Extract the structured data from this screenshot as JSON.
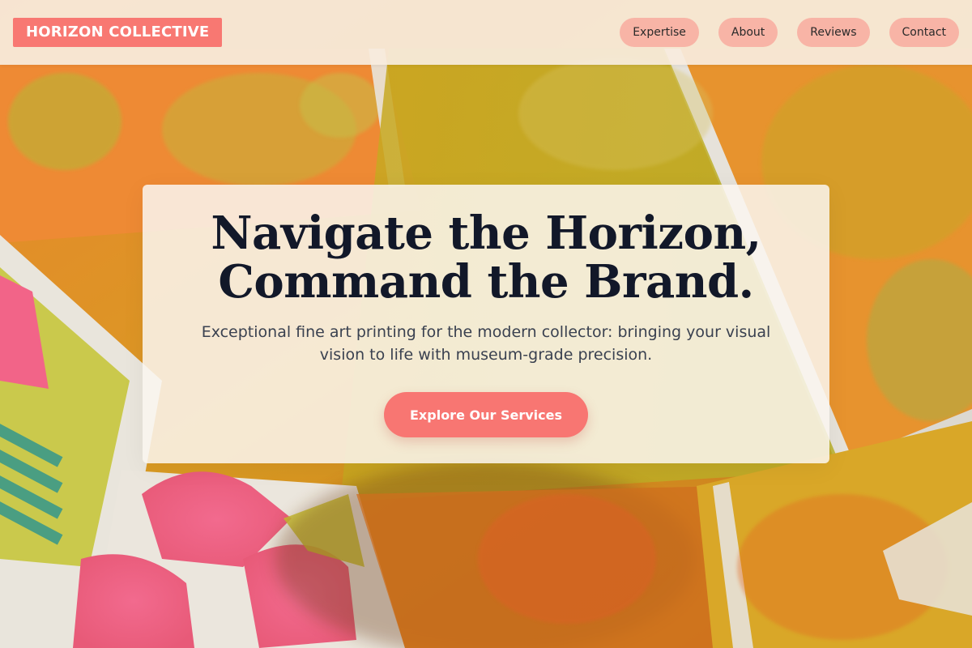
{
  "header": {
    "brand": "HORIZON COLLECTIVE",
    "nav": [
      {
        "label": "Expertise"
      },
      {
        "label": "About"
      },
      {
        "label": "Reviews"
      },
      {
        "label": "Contact"
      }
    ]
  },
  "hero": {
    "title_line1": "Navigate the Horizon,",
    "title_line2": "Command the Brand.",
    "subtitle": "Exceptional fine art printing for the modern collector: bringing your visual vision to life with museum-grade precision.",
    "cta_label": "Explore Our Services"
  },
  "colors": {
    "brand_accent": "#f87872",
    "nav_pill": "#f8b4a6",
    "title_text": "#121829",
    "body_text": "#3a4150",
    "header_bg": "#f8ecde"
  }
}
